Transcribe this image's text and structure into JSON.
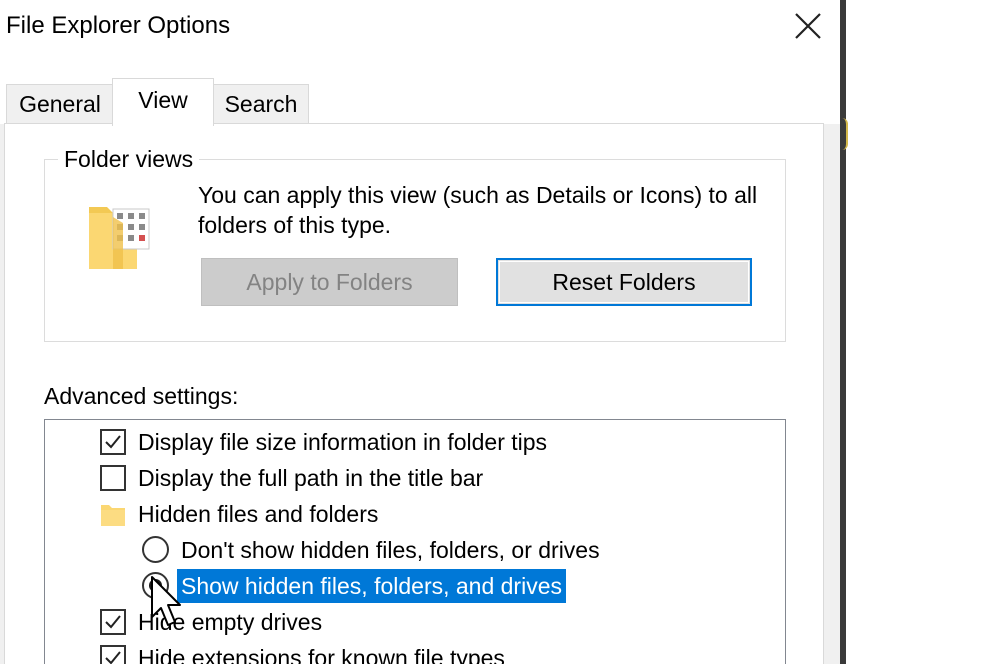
{
  "window": {
    "title": "File Explorer Options"
  },
  "tabs": [
    {
      "label": "General"
    },
    {
      "label": "View"
    },
    {
      "label": "Search"
    }
  ],
  "folder_views": {
    "legend": "Folder views",
    "description": "You can apply this view (such as Details or Icons) to all folders of this type.",
    "apply_label": "Apply to Folders",
    "reset_label": "Reset Folders"
  },
  "advanced": {
    "label": "Advanced settings:",
    "items": [
      {
        "type": "checkbox",
        "checked": true,
        "label": "Display file size information in folder tips"
      },
      {
        "type": "checkbox",
        "checked": false,
        "label": "Display the full path in the title bar"
      },
      {
        "type": "folder",
        "label": "Hidden files and folders",
        "icon": "folder-icon"
      },
      {
        "type": "radio",
        "checked": false,
        "label": "Don't show hidden files, folders, or drives"
      },
      {
        "type": "radio",
        "checked": true,
        "selected": true,
        "label": "Show hidden files, folders, and drives"
      },
      {
        "type": "checkbox",
        "checked": true,
        "label": "Hide empty drives"
      },
      {
        "type": "checkbox",
        "checked": true,
        "label": "Hide extensions for known file types"
      }
    ]
  },
  "colors": {
    "selection": "#0078d7",
    "focus_border": "#0078d7",
    "folder": "#fbd772"
  }
}
